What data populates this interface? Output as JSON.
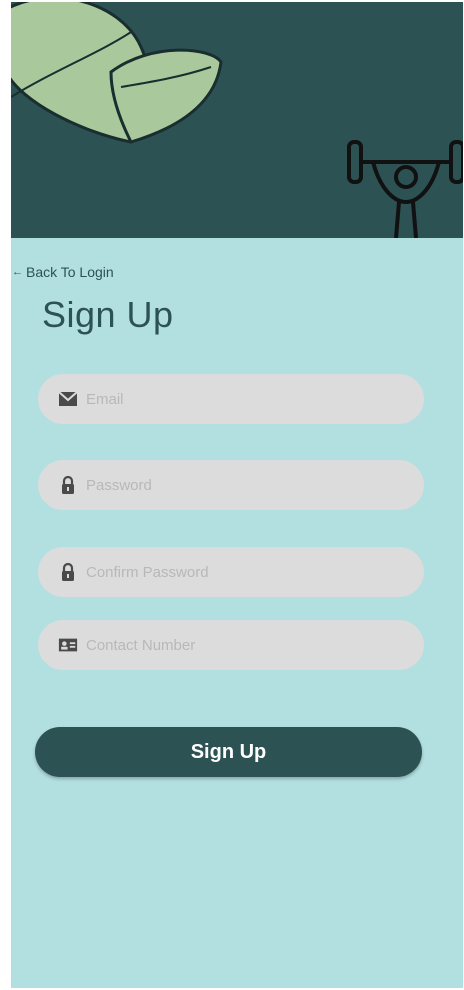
{
  "colors": {
    "header_bg": "#2d5253",
    "card_bg": "#b2dfe0",
    "field_bg": "#dcdcdc",
    "accent": "#2d5253",
    "leaf": "#a9c89c"
  },
  "header": {
    "illustrations": [
      "leaf-icon",
      "weightlifter-icon"
    ]
  },
  "nav": {
    "back_arrow": "←",
    "back_label": "Back To Login"
  },
  "form": {
    "title": "Sign Up",
    "fields": [
      {
        "icon": "email-icon",
        "placeholder": "Email",
        "value": ""
      },
      {
        "icon": "lock-icon",
        "placeholder": "Password",
        "value": ""
      },
      {
        "icon": "lock-icon",
        "placeholder": "Confirm Password",
        "value": ""
      },
      {
        "icon": "contact-card-icon",
        "placeholder": "Contact Number",
        "value": ""
      }
    ],
    "submit_label": "Sign Up"
  }
}
